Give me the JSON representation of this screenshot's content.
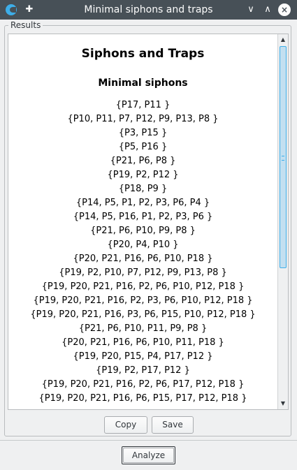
{
  "window": {
    "title": "Minimal siphons and traps",
    "controls": {
      "minimize": "∨",
      "maximize": "∧",
      "close": "×"
    }
  },
  "group": {
    "label": "Results"
  },
  "results": {
    "heading": "Siphons and Traps",
    "subheading": "Minimal siphons",
    "siphons": [
      "{P17, P11 }",
      "{P10, P11, P7, P12, P9, P13, P8 }",
      "{P3, P15 }",
      "{P5, P16 }",
      "{P21, P6, P8 }",
      "{P19, P2, P12 }",
      "{P18, P9 }",
      "{P14, P5, P1, P2, P3, P6, P4 }",
      "{P14, P5, P16, P1, P2, P3, P6 }",
      "{P21, P6, P10, P9, P8 }",
      "{P20, P4, P10 }",
      "{P20, P21, P16, P6, P10, P18 }",
      "{P19, P2, P10, P7, P12, P9, P13, P8 }",
      "{P19, P20, P21, P16, P2, P6, P10, P12, P18 }",
      "{P19, P20, P21, P16, P2, P3, P6, P10, P12, P18 }",
      "{P19, P20, P21, P16, P3, P6, P15, P10, P12, P18 }",
      "{P21, P6, P10, P11, P9, P8 }",
      "{P20, P21, P16, P6, P10, P11, P18 }",
      "{P19, P20, P15, P4, P17, P12 }",
      "{P19, P2, P17, P12 }",
      "{P19, P20, P21, P16, P2, P6, P17, P12, P18 }",
      "{P19, P20, P21, P16, P6, P15, P17, P12, P18 }"
    ]
  },
  "buttons": {
    "copy": "Copy",
    "save": "Save",
    "analyze": "Analyze"
  },
  "colors": {
    "titlebar": "#475057",
    "accent": "#3daee9",
    "background": "#eff0f1"
  }
}
